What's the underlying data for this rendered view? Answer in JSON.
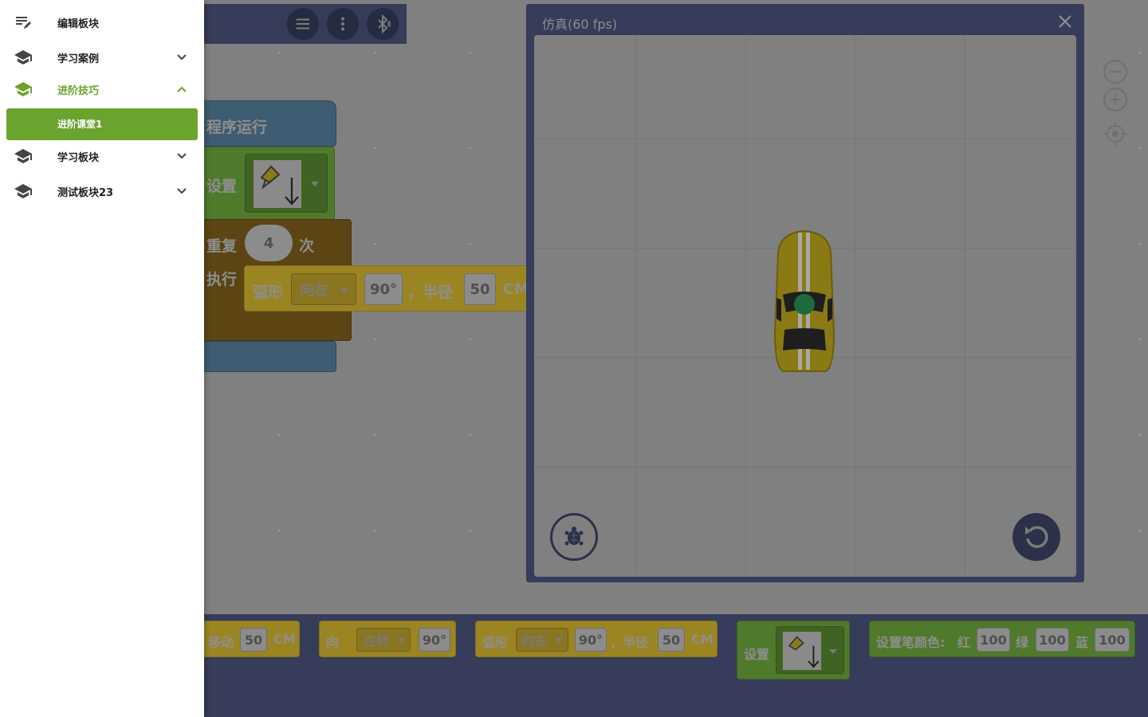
{
  "drawer": {
    "items": [
      {
        "label": "编辑板块",
        "icon": "edit-list-icon"
      },
      {
        "label": "学习案例",
        "icon": "school-icon"
      },
      {
        "label": "进阶技巧",
        "icon": "school-icon",
        "active": true
      },
      {
        "label": "学习板块",
        "icon": "school-icon"
      },
      {
        "label": "测试板块23",
        "icon": "school-icon"
      }
    ],
    "sub_item": {
      "label": "进阶课堂1"
    },
    "accent": "#6aa32e"
  },
  "toolbar": {
    "buttons": [
      "menu-icon",
      "more-vert-icon",
      "bluetooth-icon"
    ]
  },
  "workspace": {
    "event_block": "程序运行",
    "set_block": "设置",
    "repeat_label": "重复",
    "repeat_count": "4",
    "repeat_unit": "次",
    "do_label": "执行",
    "arc_block": {
      "label": "弧形",
      "direction": "向左",
      "angle": "90°",
      "radius_label": "，半径",
      "radius": "50",
      "unit": "CM"
    }
  },
  "sim": {
    "title": "仿真(60 fps)",
    "close_icon": "close-icon",
    "turtle_icon": "turtle-icon",
    "reset_icon": "reset-icon"
  },
  "palette": {
    "move": {
      "label": "移动",
      "value": "50",
      "unit": "CM"
    },
    "turn": {
      "label": "向",
      "direction": "左转",
      "angle": "90°"
    },
    "arc": {
      "label": "弧形",
      "direction": "向左",
      "angle": "90°",
      "radius_label": "，半径",
      "radius": "50",
      "unit": "CM"
    },
    "set": {
      "label": "设置"
    },
    "pen_color": {
      "label": "设置笔颜色:",
      "red_label": "红",
      "red": "100",
      "green_label": "绿",
      "green": "100",
      "blue_label": "蓝",
      "blue": "100"
    }
  }
}
